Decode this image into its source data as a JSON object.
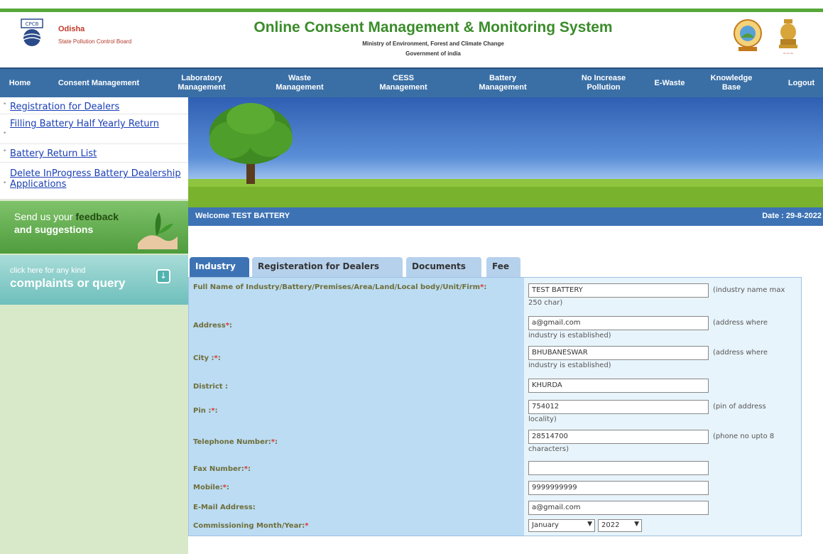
{
  "header": {
    "org_name": "Odisha",
    "org_sub": "State Pollution Control Board",
    "title": "Online Consent Management & Monitoring System",
    "subtitle1": "Ministry of Environment, Forest and Climate Change",
    "subtitle2": "Government of india"
  },
  "nav": [
    {
      "label": "Home"
    },
    {
      "label": "Consent Management"
    },
    {
      "label": "Laboratory Management"
    },
    {
      "label": "Waste Management"
    },
    {
      "label": "CESS Management"
    },
    {
      "label": "Battery Management"
    },
    {
      "label": "No Increase Pollution"
    },
    {
      "label": "E-Waste"
    },
    {
      "label": "Knowledge Base"
    },
    {
      "label": "Logout"
    }
  ],
  "sidebar": {
    "links": [
      {
        "label": "Registration for Dealers"
      },
      {
        "label": "Filling Battery Half Yearly Return"
      },
      {
        "label": "Battery Return List"
      },
      {
        "label": "Delete InProgress Battery Dealership Applications"
      }
    ],
    "feedback_line1": "Send us your",
    "feedback_hl": "feedback",
    "feedback_line2": "and suggestions",
    "complaints_small": "click here for any kind",
    "complaints_big": "complaints or query"
  },
  "welcome": {
    "text": "Welcome TEST BATTERY",
    "date": "Date : 29-8-2022"
  },
  "tabs": [
    {
      "label": "Industry",
      "active": true
    },
    {
      "label": "Registeration for Dealers",
      "active": false
    },
    {
      "label": "Documents",
      "active": false
    },
    {
      "label": "Fee",
      "active": false
    }
  ],
  "form": {
    "fields": [
      {
        "label": "Full Name of Industry/Battery/Premises/Area/Land/Local body/Unit/Firm",
        "req": "*",
        "value": "TEST BATTERY",
        "hint1": "(industry name max",
        "hint2": "250 char)"
      },
      {
        "label": "Address",
        "req": "*",
        "value": "a@gmail.com",
        "hint1": "(address where",
        "hint2": "industry is established)"
      },
      {
        "label": "City :",
        "req": "*",
        "value": "BHUBANESWAR",
        "hint1": "(address where",
        "hint2": "industry is established)"
      },
      {
        "label": "District :",
        "req": "",
        "value": "KHURDA",
        "hint1": "",
        "hint2": ""
      },
      {
        "label": "Pin :",
        "req": "*",
        "value": "754012",
        "hint1": "(pin of address",
        "hint2": "locality)"
      },
      {
        "label": "Telephone Number:",
        "req": "*",
        "value": "28514700",
        "hint1": "(phone no upto 8",
        "hint2": "characters)"
      },
      {
        "label": "Fax Number:",
        "req": "*",
        "value": "",
        "hint1": "",
        "hint2": ""
      },
      {
        "label": "Mobile:",
        "req": "*",
        "value": "9999999999",
        "hint1": "",
        "hint2": ""
      },
      {
        "label": "E-Mail Address:",
        "req": "",
        "value": "a@gmail.com",
        "hint1": "",
        "hint2": ""
      }
    ],
    "commissioning_label": "Commissioning Month/Year:",
    "commissioning_req": "*",
    "month": "January",
    "year": "2022"
  }
}
